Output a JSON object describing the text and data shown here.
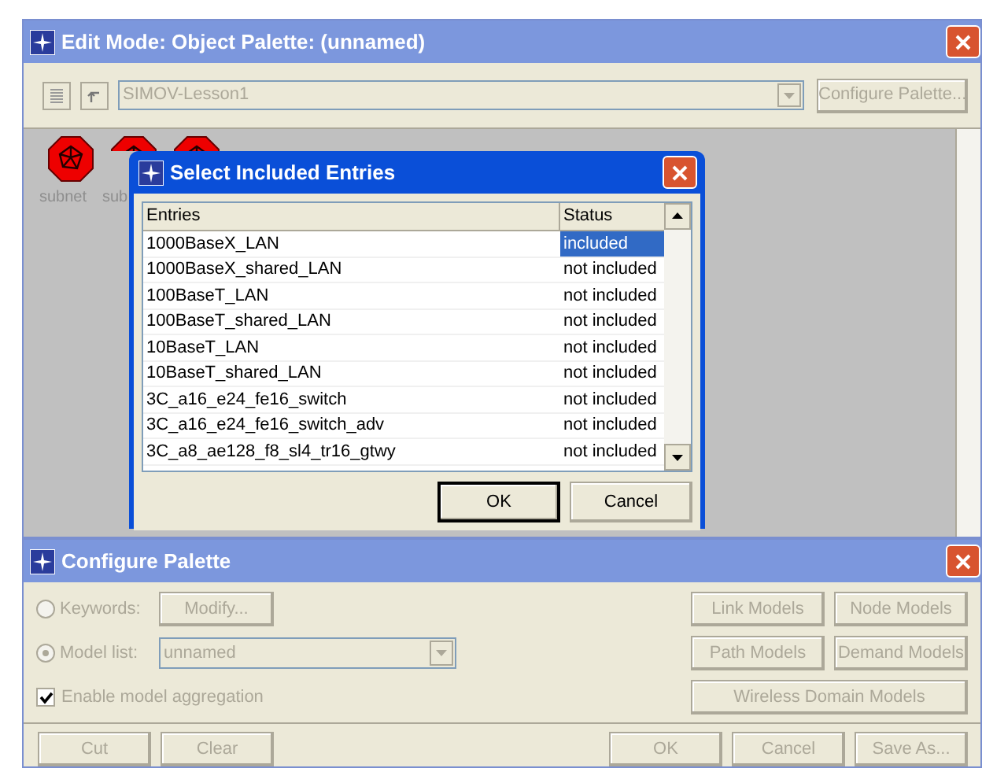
{
  "main_window": {
    "title": "Edit Mode: Object Palette: (unnamed)",
    "path_field": "SIMOV-Lesson1",
    "configure_button": "Configure Palette...",
    "palette_items": [
      {
        "kind": "labeled",
        "label": "subnet"
      },
      {
        "kind": "labeled",
        "label": "sub"
      },
      {
        "kind": "icon_only"
      }
    ]
  },
  "dialog": {
    "title": "Select Included Entries",
    "columns": [
      "Entries",
      "Status"
    ],
    "rows": [
      {
        "entry": "1000BaseX_LAN",
        "status": "included",
        "selected": true
      },
      {
        "entry": "1000BaseX_shared_LAN",
        "status": "not included",
        "selected": false
      },
      {
        "entry": "100BaseT_LAN",
        "status": "not included",
        "selected": false
      },
      {
        "entry": "100BaseT_shared_LAN",
        "status": "not included",
        "selected": false
      },
      {
        "entry": "10BaseT_LAN",
        "status": "not included",
        "selected": false
      },
      {
        "entry": "10BaseT_shared_LAN",
        "status": "not included",
        "selected": false
      },
      {
        "entry": "3C_a16_e24_fe16_switch",
        "status": "not included",
        "selected": false
      },
      {
        "entry": "3C_a16_e24_fe16_switch_adv",
        "status": "not included",
        "selected": false
      },
      {
        "entry": "3C_a8_ae128_f8_sl4_tr16_gtwy",
        "status": "not included",
        "selected": false
      }
    ],
    "buttons": [
      {
        "label": "OK",
        "default": true
      },
      {
        "label": "Cancel",
        "default": false
      }
    ]
  },
  "configure_palette": {
    "title": "Configure Palette",
    "disabled": true,
    "keywords": {
      "label": "Keywords:",
      "selected": false,
      "button": "Modify..."
    },
    "model_list": {
      "label": "Model list:",
      "selected": true,
      "value": "unnamed"
    },
    "aggregation": {
      "label": "Enable model aggregation",
      "checked": true
    },
    "model_buttons": [
      "Link Models",
      "Node Models",
      "Path Models",
      "Demand Models"
    ],
    "wireless_button": "Wireless Domain Models",
    "left_buttons": [
      "Cut",
      "Clear"
    ],
    "right_buttons": [
      "OK",
      "Cancel",
      "Save As..."
    ]
  }
}
